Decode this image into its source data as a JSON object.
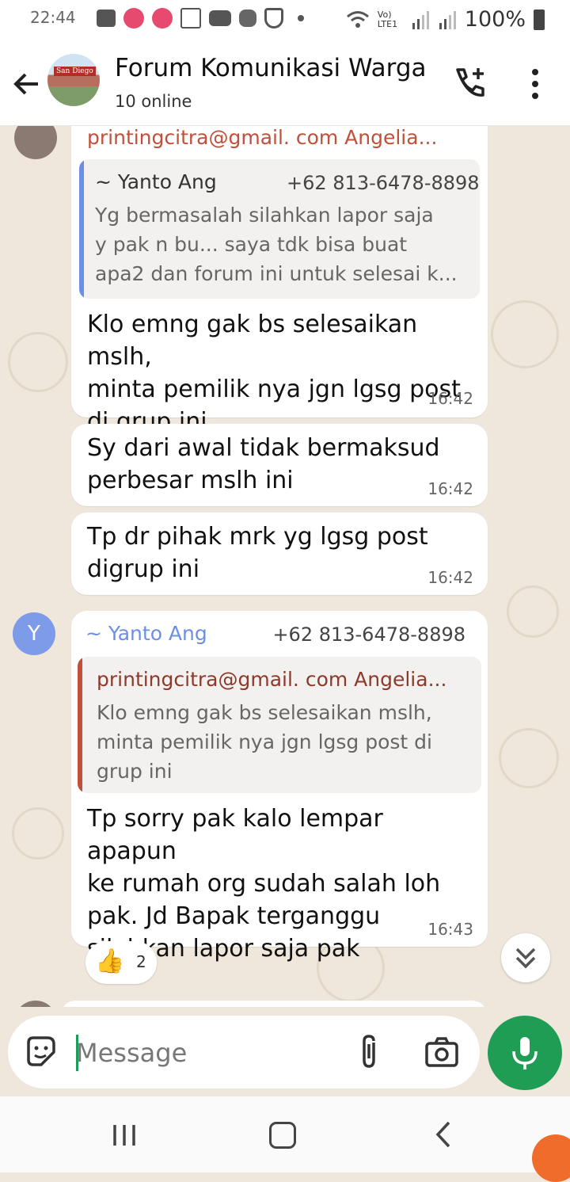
{
  "status_bar": {
    "time": "22:44",
    "network": "Vo) LTE1",
    "battery": "100%"
  },
  "header": {
    "back_icon": "arrow-left-icon",
    "avatar_sign": "San Diego",
    "title": "Forum Komunikasi Warga",
    "subtitle": "10 online",
    "call_icon": "phone-plus-icon",
    "menu_icon": "more-vertical-icon"
  },
  "messages": [
    {
      "sender": "printingcitra@gmail. com Angelia...",
      "quote": {
        "name": "~ Yanto Ang",
        "phone": "+62 813-6478-8898",
        "lines": [
          "Yg bermasalah silahkan lapor saja",
          "y pak n bu... saya tdk bisa buat",
          "apa2 dan forum ini untuk selesai k..."
        ]
      },
      "lines": [
        "Klo emng gak bs selesaikan mslh,",
        "minta pemilik nya jgn lgsg post",
        "di grup ini"
      ],
      "time": "16:42"
    },
    {
      "lines": [
        "Sy dari awal tidak bermaksud",
        "perbesar mslh ini"
      ],
      "time": "16:42"
    },
    {
      "lines": [
        "Tp dr pihak mrk yg lgsg post",
        "digrup ini"
      ],
      "time": "16:42"
    },
    {
      "avatar_letter": "Y",
      "sender": "~ Yanto Ang",
      "phone": "+62 813-6478-8898",
      "quote": {
        "name": "printingcitra@gmail. com Angelia...",
        "lines": [
          "Klo emng gak bs selesaikan mslh,",
          "minta pemilik nya jgn lgsg post di",
          "grup ini"
        ]
      },
      "lines": [
        "Tp sorry pak kalo lempar apapun",
        "ke rumah org sudah salah loh",
        "pak. Jd Bapak terganggu",
        "silahkan lapor saja pak"
      ],
      "time": "16:43",
      "reaction": {
        "emoji": "👍",
        "count": "2"
      }
    }
  ],
  "input": {
    "placeholder": "Message",
    "emoji_icon": "sticker-icon",
    "attach_icon": "paperclip-icon",
    "camera_icon": "camera-icon",
    "mic_icon": "mic-icon"
  },
  "colors": {
    "chat_bg": "#efe7dc",
    "accent_green": "#1f9d55",
    "sender_orange": "#c1503a",
    "quote_blue": "#6c8fe6",
    "quote_orange": "#c1503a",
    "avatar_y": "#7d9be9"
  }
}
